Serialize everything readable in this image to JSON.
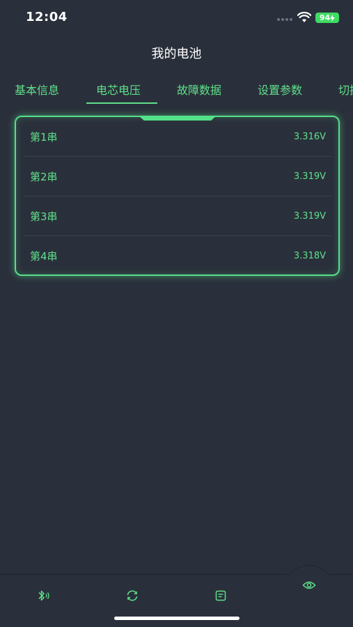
{
  "status_bar": {
    "time": "12:04",
    "battery": "94"
  },
  "header": {
    "title": "我的电池"
  },
  "tabs": [
    {
      "label": "基本信息",
      "active": false
    },
    {
      "label": "电芯电压",
      "active": true
    },
    {
      "label": "故障数据",
      "active": false
    },
    {
      "label": "设置参数",
      "active": false
    },
    {
      "label": "切换",
      "active": false
    }
  ],
  "cells": [
    {
      "name": "第1串",
      "voltage": "3.316V"
    },
    {
      "name": "第2串",
      "voltage": "3.319V"
    },
    {
      "name": "第3串",
      "voltage": "3.319V"
    },
    {
      "name": "第4串",
      "voltage": "3.318V"
    }
  ],
  "bottom_nav": [
    {
      "icon": "bluetooth-icon"
    },
    {
      "icon": "refresh-icon"
    },
    {
      "icon": "document-icon"
    },
    {
      "icon": "eye-icon"
    }
  ],
  "colors": {
    "background": "#2a303b",
    "accent": "#5fe08a",
    "battery": "#3ddc62"
  }
}
